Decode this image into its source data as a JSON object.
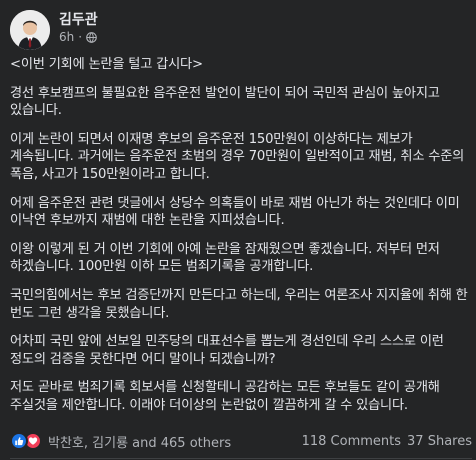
{
  "post": {
    "author": "김두관",
    "time": "6h",
    "separator": "·",
    "paragraphs": [
      "<이번 기회에 논란을 털고 갑시다>",
      "경선 후보캠프의 불필요한 음주운전 발언이 발단이 되어 국민적 관심이 높아지고 있습니다.",
      "이게 논란이 되면서 이재명 후보의 음주운전 150만원이 이상하다는 제보가 계속됩니다. 과거에는 음주운전 초범의 경우 70만원이 일반적이고 재범, 취소 수준의 폭음, 사고가 150만원이라고 합니다.",
      "어제 음주운전 관련 댓글에서 상당수 의혹들이 바로 재범 아닌가 하는 것인데다 이미 이낙연 후보까지 재범에 대한 논란을 지피셨습니다.",
      "이왕 이렇게 된 거 이번 기회에 아예 논란을 잠재웠으면 좋겠습니다. 저부터 먼저 하겠습니다. 100만원 이하 모든 범죄기록을 공개합니다.",
      "국민의힘에서는 후보 검증단까지 만든다고 하는데, 우리는 여론조사 지지율에 취해 한 번도 그런 생각을 못했습니다.",
      "어차피 국민 앞에 선보일 민주당의 대표선수를 뽑는게 경선인데 우리 스스로 이런 정도의 검증을 못한다면 어디 말이나 되겠습니까?",
      "저도 곧바로 범죄기록 회보서를 신청할테니 공감하는 모든 후보들도 같이 공개해 주실것을 제안합니다. 이래야 더이상의 논란없이 깔끔하게 갈 수 있습니다."
    ]
  },
  "footer": {
    "reactions_label": "박찬호, 김기룡 and 465 others",
    "comments": "118 Comments",
    "shares": "37 Shares"
  },
  "colors": {
    "background": "#242526",
    "text": "#e4e6eb",
    "secondary": "#b0b3b8",
    "like": "#1b74e4",
    "love": "#f33e58"
  },
  "icons": [
    "avatar",
    "globe-icon",
    "like-reaction-icon",
    "love-reaction-icon"
  ]
}
